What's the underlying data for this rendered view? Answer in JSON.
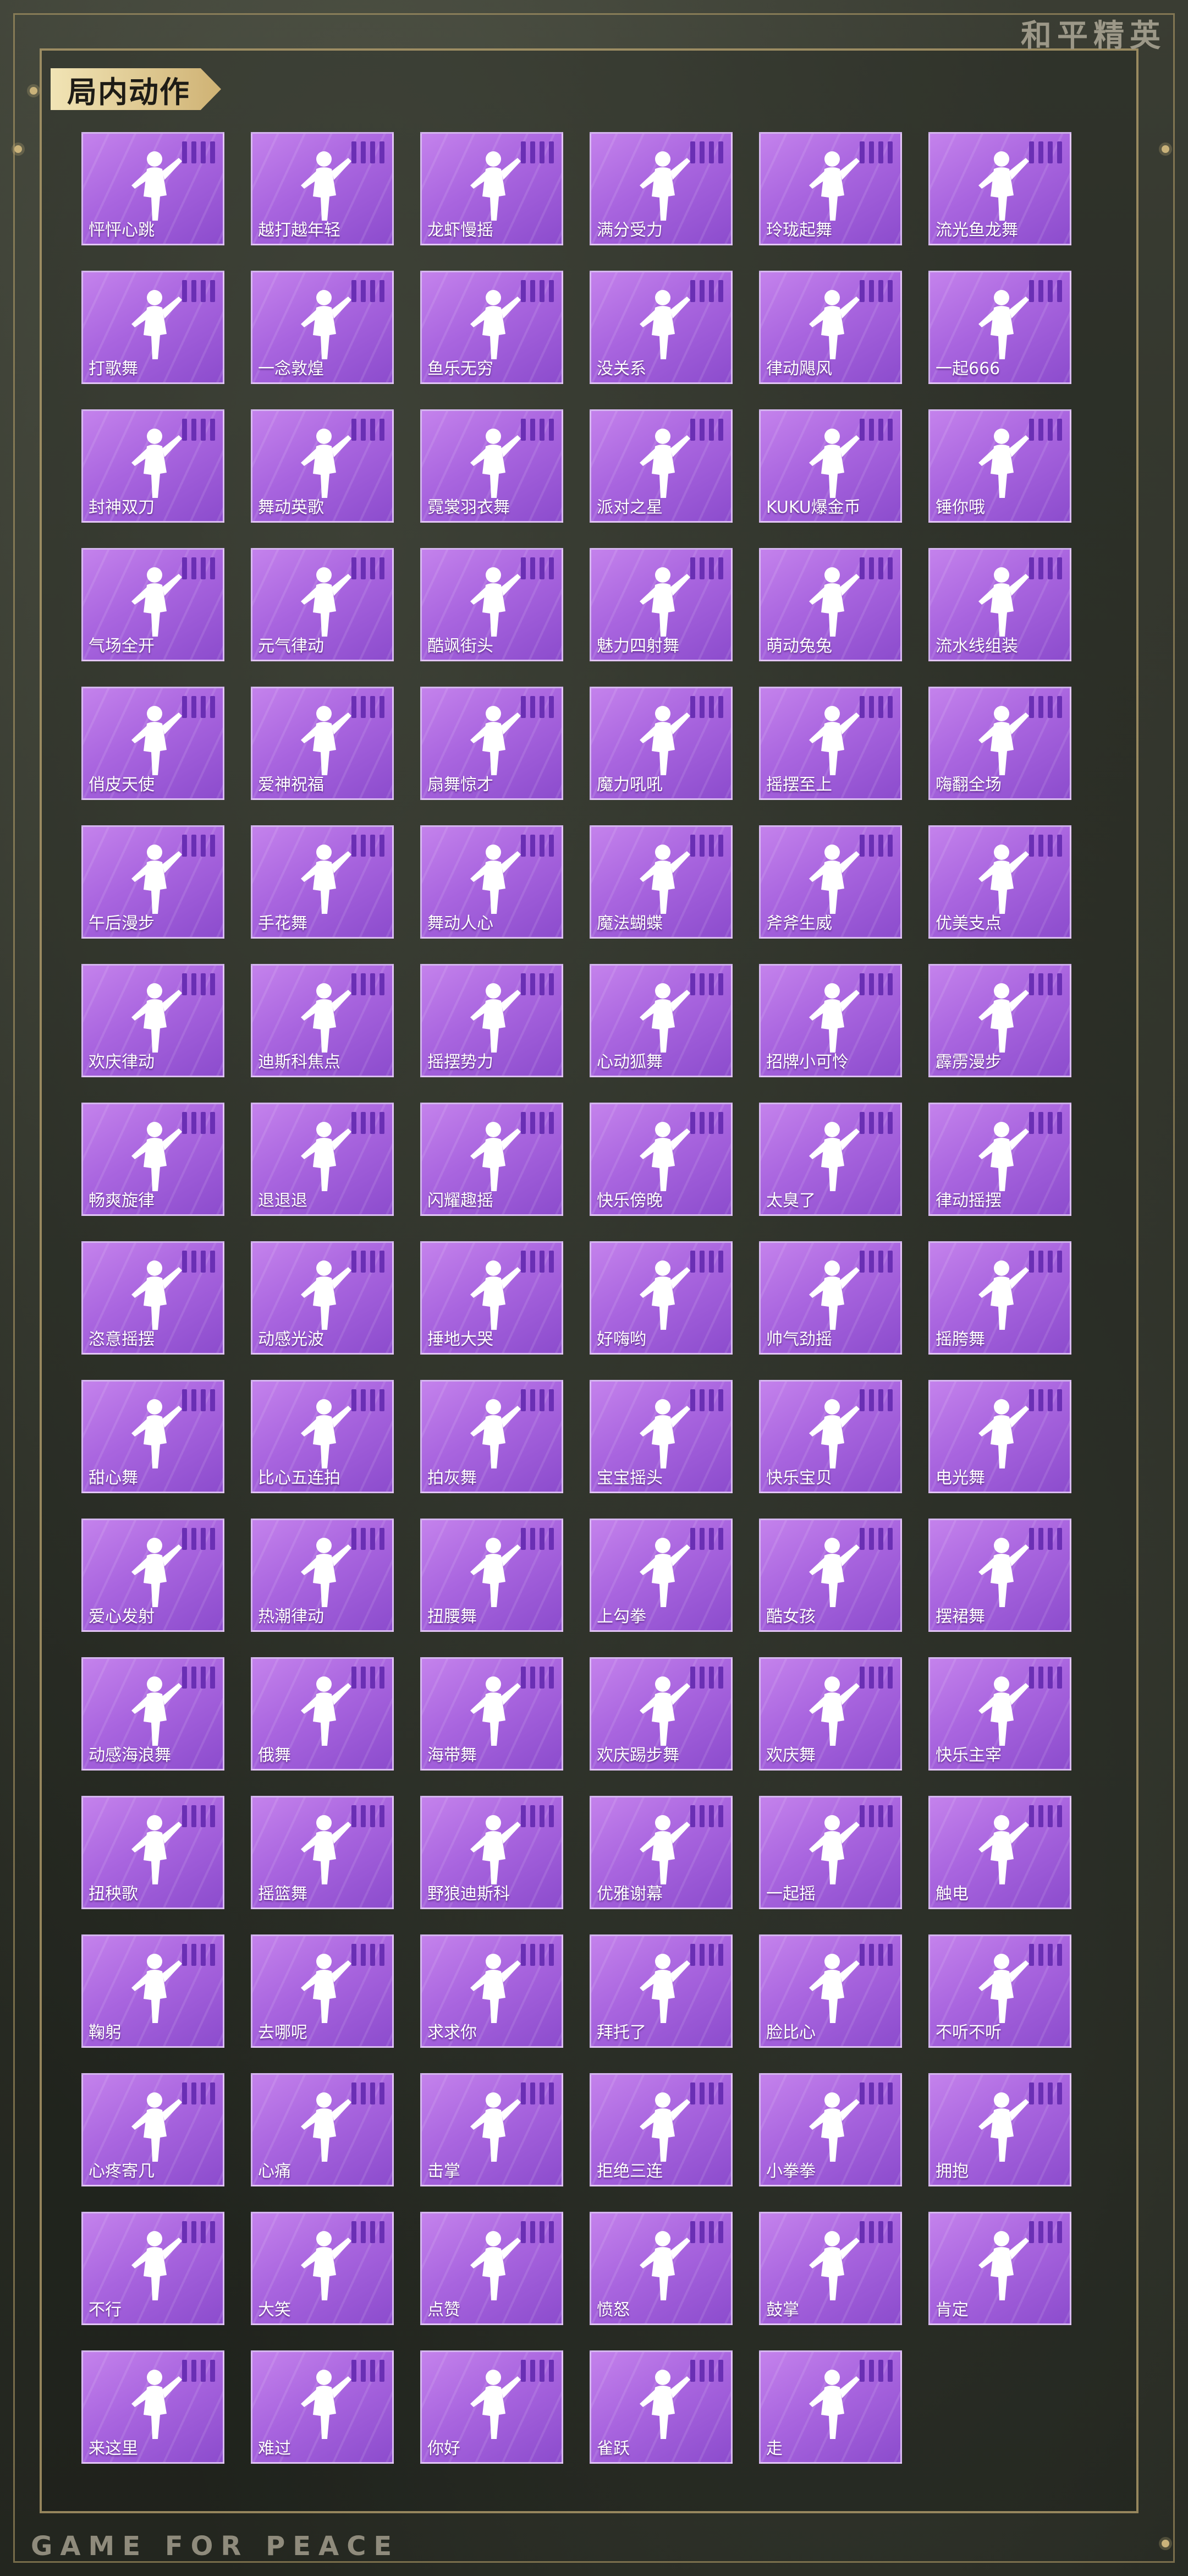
{
  "brand": "和平精英",
  "footer_brand": "GAME FOR PEACE",
  "section_title": "局内动作",
  "emotes": [
    "怦怦心跳",
    "越打越年轻",
    "龙虾慢摇",
    "满分受力",
    "玲珑起舞",
    "流光鱼龙舞",
    "打歌舞",
    "一念敦煌",
    "鱼乐无穷",
    "没关系",
    "律动飓风",
    "一起666",
    "封神双刀",
    "舞动英歌",
    "霓裳羽衣舞",
    "派对之星",
    "KUKU爆金币",
    "锤你哦",
    "气场全开",
    "元气律动",
    "酷飒街头",
    "魅力四射舞",
    "萌动兔兔",
    "流水线组装",
    "俏皮天使",
    "爱神祝福",
    "扇舞惊才",
    "魔力吼吼",
    "摇摆至上",
    "嗨翻全场",
    "午后漫步",
    "手花舞",
    "舞动人心",
    "魔法蝴蝶",
    "斧斧生威",
    "优美支点",
    "欢庆律动",
    "迪斯科焦点",
    "摇摆势力",
    "心动狐舞",
    "招牌小可怜",
    "霹雳漫步",
    "畅爽旋律",
    "退退退",
    "闪耀趣摇",
    "快乐傍晚",
    "太臭了",
    "律动摇摆",
    "恣意摇摆",
    "动感光波",
    "捶地大哭",
    "好嗨哟",
    "帅气劲摇",
    "摇胯舞",
    "甜心舞",
    "比心五连拍",
    "拍灰舞",
    "宝宝摇头",
    "快乐宝贝",
    "电光舞",
    "爱心发射",
    "热潮律动",
    "扭腰舞",
    "上勾拳",
    "酷女孩",
    "摆裙舞",
    "动感海浪舞",
    "俄舞",
    "海带舞",
    "欢庆踢步舞",
    "欢庆舞",
    "快乐主宰",
    "扭秧歌",
    "摇篮舞",
    "野狼迪斯科",
    "优雅谢幕",
    "一起摇",
    "触电",
    "鞠躬",
    "去哪呢",
    "求求你",
    "拜托了",
    "脸比心",
    "不听不听",
    "心疼寄几",
    "心痛",
    "击掌",
    "拒绝三连",
    "小拳拳",
    "拥抱",
    "不行",
    "大笑",
    "点赞",
    "愤怒",
    "鼓掌",
    "肯定",
    "来这里",
    "难过",
    "你好",
    "雀跃",
    "走"
  ]
}
